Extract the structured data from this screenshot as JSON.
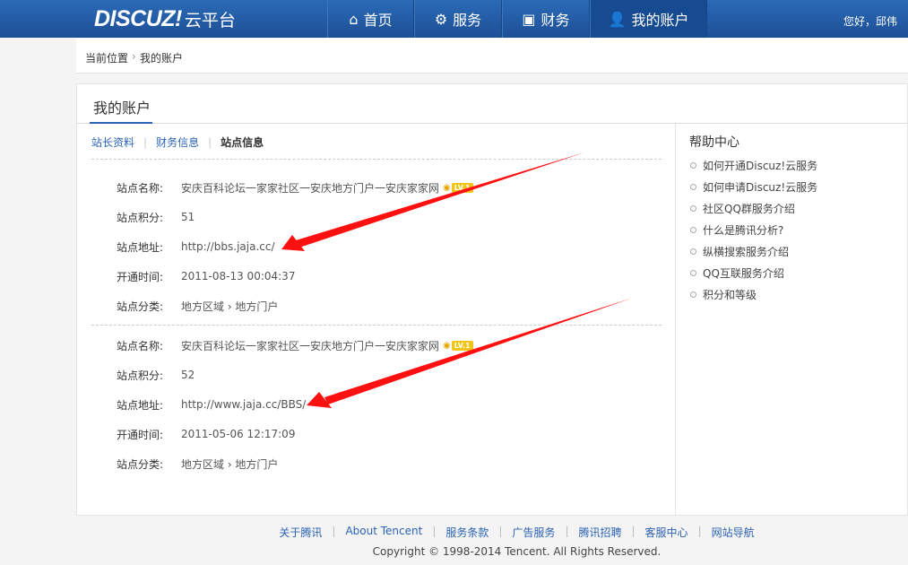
{
  "header": {
    "logo_brand": "DISCUZ!",
    "logo_sub": "云平台",
    "nav": [
      {
        "label": "首页",
        "icon": "home-icon",
        "glyph": "⌂"
      },
      {
        "label": "服务",
        "icon": "gear-icon",
        "glyph": "⚙"
      },
      {
        "label": "财务",
        "icon": "finance-icon",
        "glyph": "▣"
      },
      {
        "label": "我的账户",
        "icon": "user-icon",
        "glyph": "👤"
      }
    ],
    "active_nav": "我的账户",
    "greeting": "您好，邱伟"
  },
  "breadcrumb": {
    "root": "当前位置",
    "separator": "›",
    "current": "我的账户"
  },
  "page": {
    "title": "我的账户",
    "tabs": [
      "站长资料",
      "财务信息",
      "站点信息"
    ],
    "active_tab": "站点信息"
  },
  "field_labels": {
    "name": "站点名称:",
    "score": "站点积分:",
    "url": "站点地址:",
    "opened": "开通时间:",
    "category": "站点分类:"
  },
  "sites": [
    {
      "name": "安庆百科论坛一家家社区一安庆地方门户一安庆家家网",
      "level": "LV.1",
      "score": "51",
      "url": "http://bbs.jaja.cc/",
      "opened": "2011-08-13 00:04:37",
      "category": "地方区域 › 地方门户"
    },
    {
      "name": "安庆百科论坛一家家社区一安庆地方门户一安庆家家网",
      "level": "LV.1",
      "score": "52",
      "url": "http://www.jaja.cc/BBS/",
      "opened": "2011-05-06 12:17:09",
      "category": "地方区域 › 地方门户"
    }
  ],
  "help": {
    "title": "帮助中心",
    "items": [
      "如何开通Discuz!云服务",
      "如何申请Discuz!云服务",
      "社区QQ群服务介绍",
      "什么是腾讯分析?",
      "纵横搜索服务介绍",
      "QQ互联服务介绍",
      "积分和等级"
    ]
  },
  "footer": {
    "links": [
      "关于腾讯",
      "About Tencent",
      "服务条款",
      "广告服务",
      "腾讯招聘",
      "客服中心",
      "网站导航"
    ],
    "separator": "|",
    "copyright": "Copyright © 1998-2014 Tencent. All Rights Reserved."
  },
  "colors": {
    "header_bg": "#1d4f96",
    "link": "#2b62b3",
    "annotation_arrow": "#ff1010"
  }
}
